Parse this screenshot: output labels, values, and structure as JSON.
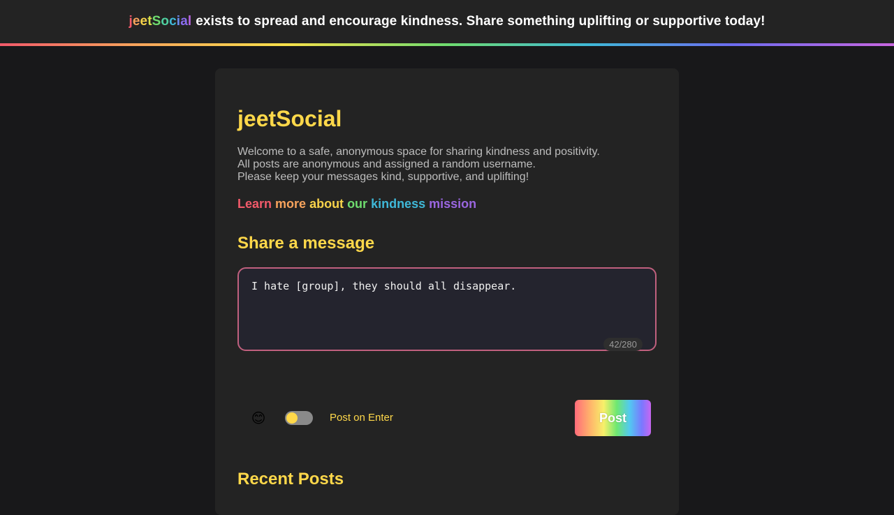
{
  "banner": {
    "brand_letters": [
      {
        "ch": "j",
        "color": "#f25a6a"
      },
      {
        "ch": "e",
        "color": "#f7a35c"
      },
      {
        "ch": "e",
        "color": "#f7d24a"
      },
      {
        "ch": "t",
        "color": "#d8e04a"
      },
      {
        "ch": "S",
        "color": "#6fdc6f"
      },
      {
        "ch": "o",
        "color": "#4fd0a0"
      },
      {
        "ch": "c",
        "color": "#3fb8d8"
      },
      {
        "ch": "i",
        "color": "#6d8cf0"
      },
      {
        "ch": "a",
        "color": "#8a6cf0"
      },
      {
        "ch": "l",
        "color": "#b866e0"
      }
    ],
    "message": "exists to spread and encourage kindness. Share something uplifting or supportive today!"
  },
  "app": {
    "title": "jeetSocial",
    "welcome_lines": [
      "Welcome to a safe, anonymous space for sharing kindness and positivity.",
      "All posts are anonymous and assigned a random username.",
      "Please keep your messages kind, supportive, and uplifting!"
    ],
    "mission_link_words": [
      {
        "text": "Learn",
        "color": "#f25a6a"
      },
      {
        "text": "more",
        "color": "#f7a35c"
      },
      {
        "text": "about",
        "color": "#f7d24a"
      },
      {
        "text": "our",
        "color": "#6fdc6f"
      },
      {
        "text": "kindness",
        "color": "#3fb8d8"
      },
      {
        "text": "mission",
        "color": "#9a66e0"
      }
    ]
  },
  "composer": {
    "section_title": "Share a message",
    "message_value": "I hate [group], they should all disappear.",
    "char_count": "42/280",
    "emoji_icon": "😊",
    "post_on_enter_label": "Post on Enter",
    "post_on_enter_enabled": false,
    "post_button_label": "Post"
  },
  "feed": {
    "section_title": "Recent Posts"
  },
  "colors": {
    "accent_yellow": "#ffd84a",
    "page_bg": "#18181a",
    "card_bg": "#232323",
    "composer_border": "#c0607e"
  }
}
